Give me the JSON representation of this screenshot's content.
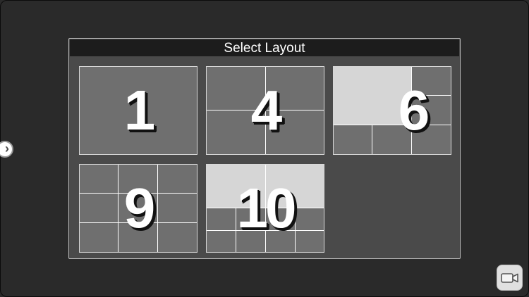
{
  "dialog": {
    "title": "Select Layout"
  },
  "layouts": [
    {
      "id": "layout-1",
      "label": "1"
    },
    {
      "id": "layout-4",
      "label": "4"
    },
    {
      "id": "layout-6",
      "label": "6"
    },
    {
      "id": "layout-9",
      "label": "9"
    },
    {
      "id": "layout-10",
      "label": "10"
    }
  ],
  "buttons": {
    "side_arrow_icon": "chevron-right-icon",
    "camera_icon": "video-camera-icon"
  },
  "colors": {
    "tile_fill": "#6f6f6f",
    "tile_highlight": "#d6d6d6",
    "panel_bg": "#4a4a4a",
    "header_bg": "#1c1c1c"
  }
}
